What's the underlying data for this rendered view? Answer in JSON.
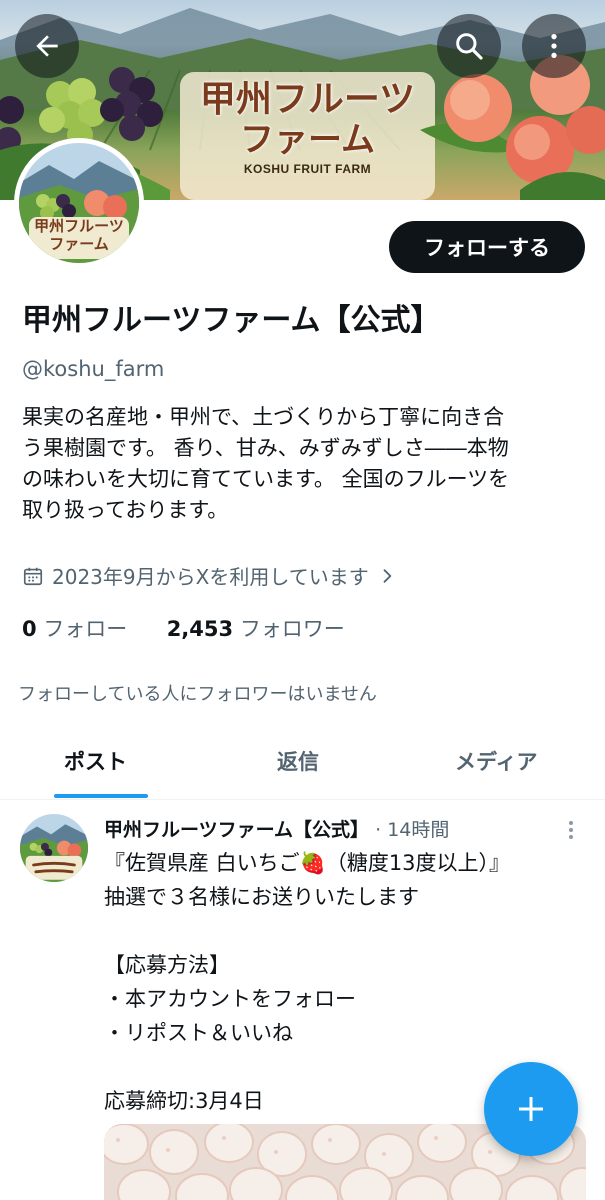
{
  "header": {
    "banner_title_line1": "甲州フルーツ",
    "banner_title_line2": "ファーム",
    "banner_subtitle": "KOSHU FRUIT FARM",
    "back_icon": "arrow-left-icon",
    "search_icon": "search-icon",
    "more_icon": "more-vertical-icon"
  },
  "avatar": {
    "logo_line1": "甲州フルーツ",
    "logo_line2": "ファーム"
  },
  "profile": {
    "follow_label": "フォローする",
    "display_name": "甲州フルーツファーム【公式】",
    "handle": "@koshu_farm",
    "bio_lines": [
      "果実の名産地・甲州で、土づくりから丁寧に向き合",
      "う果樹園です。 香り、甘み、みずみずしさ――本物",
      "の味わいを大切に育てています。 全国のフルーツを",
      "取り扱っております。"
    ],
    "joined": "2023年9月からXを利用しています",
    "following_count": "0",
    "following_label": "フォロー",
    "followers_count": "2,453",
    "followers_label": "フォロワー",
    "mutual_note": "フォローしている人にフォロワーはいません"
  },
  "tabs": [
    {
      "label": "ポスト",
      "active": true
    },
    {
      "label": "返信",
      "active": false
    },
    {
      "label": "メディア",
      "active": false
    }
  ],
  "post": {
    "author": "甲州フルーツファーム【公式】",
    "time": "· 14時間",
    "lines": [
      "『佐賀県産 白いちご🍓（糖度13度以上）』",
      "抽選で３名様にお送りいたします",
      "",
      "【応募方法】",
      "・本アカウントをフォロー",
      "・リポスト＆いいね",
      "",
      "応募締切:3月4日"
    ]
  },
  "colors": {
    "accent": "#1d9bf0",
    "text_primary": "#0f1419",
    "text_secondary": "#536471"
  },
  "fab_icon": "plus-icon"
}
